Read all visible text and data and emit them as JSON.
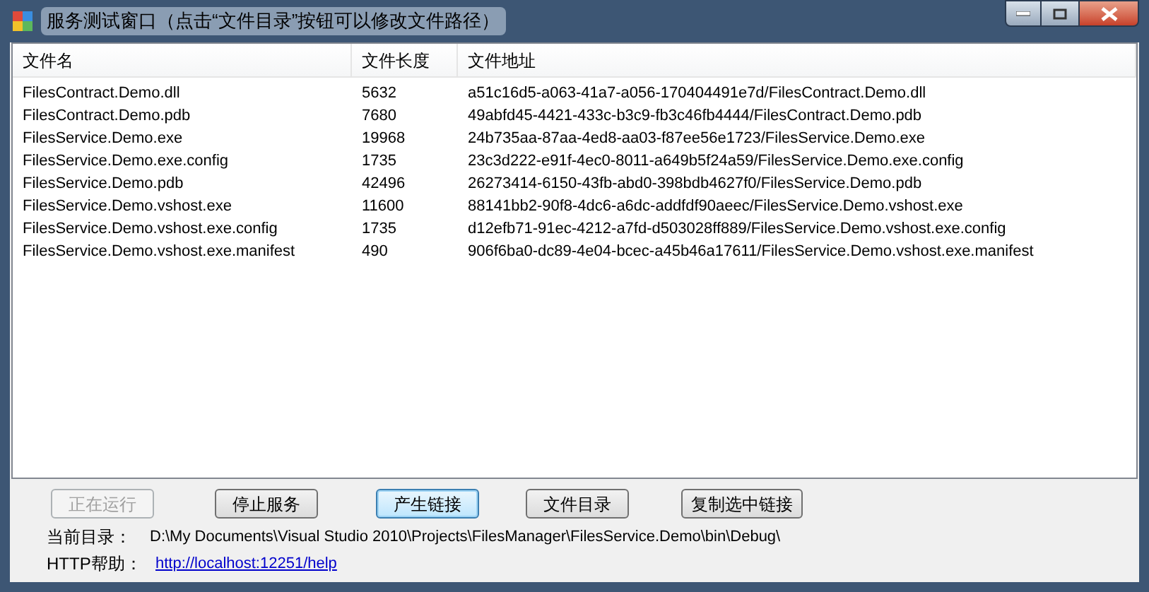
{
  "window": {
    "title": "服务测试窗口（点击“文件目录”按钮可以修改文件路径）"
  },
  "table": {
    "columns": [
      "文件名",
      "文件长度",
      "文件地址"
    ],
    "rows": [
      [
        "FilesContract.Demo.dll",
        "5632",
        "a51c16d5-a063-41a7-a056-170404491e7d/FilesContract.Demo.dll"
      ],
      [
        "FilesContract.Demo.pdb",
        "7680",
        "49abfd45-4421-433c-b3c9-fb3c46fb4444/FilesContract.Demo.pdb"
      ],
      [
        "FilesService.Demo.exe",
        "19968",
        "24b735aa-87aa-4ed8-aa03-f87ee56e1723/FilesService.Demo.exe"
      ],
      [
        "FilesService.Demo.exe.config",
        "1735",
        "23c3d222-e91f-4ec0-8011-a649b5f24a59/FilesService.Demo.exe.config"
      ],
      [
        "FilesService.Demo.pdb",
        "42496",
        "26273414-6150-43fb-abd0-398bdb4627f0/FilesService.Demo.pdb"
      ],
      [
        "FilesService.Demo.vshost.exe",
        "11600",
        "88141bb2-90f8-4dc6-a6dc-addfdf90aeec/FilesService.Demo.vshost.exe"
      ],
      [
        "FilesService.Demo.vshost.exe.config",
        "1735",
        "d12efb71-91ec-4212-a7fd-d503028ff889/FilesService.Demo.vshost.exe.config"
      ],
      [
        "FilesService.Demo.vshost.exe.manifest",
        "490",
        "906f6ba0-dc89-4e04-bcec-a45b46a17611/FilesService.Demo.vshost.exe.manifest"
      ]
    ]
  },
  "buttons": [
    {
      "label": "正在运行",
      "disabled": true,
      "focused": false
    },
    {
      "label": "停止服务",
      "disabled": false,
      "focused": false
    },
    {
      "label": "产生链接",
      "disabled": false,
      "focused": true
    },
    {
      "label": "文件目录",
      "disabled": false,
      "focused": false
    },
    {
      "label": "复制选中链接",
      "disabled": false,
      "focused": false
    }
  ],
  "current_dir": {
    "label": "当前目录：",
    "value": "D:\\My Documents\\Visual Studio 2010\\Projects\\FilesManager\\FilesService.Demo\\bin\\Debug\\"
  },
  "http_help": {
    "label": "HTTP帮助：",
    "link": "http://localhost:12251/help"
  }
}
